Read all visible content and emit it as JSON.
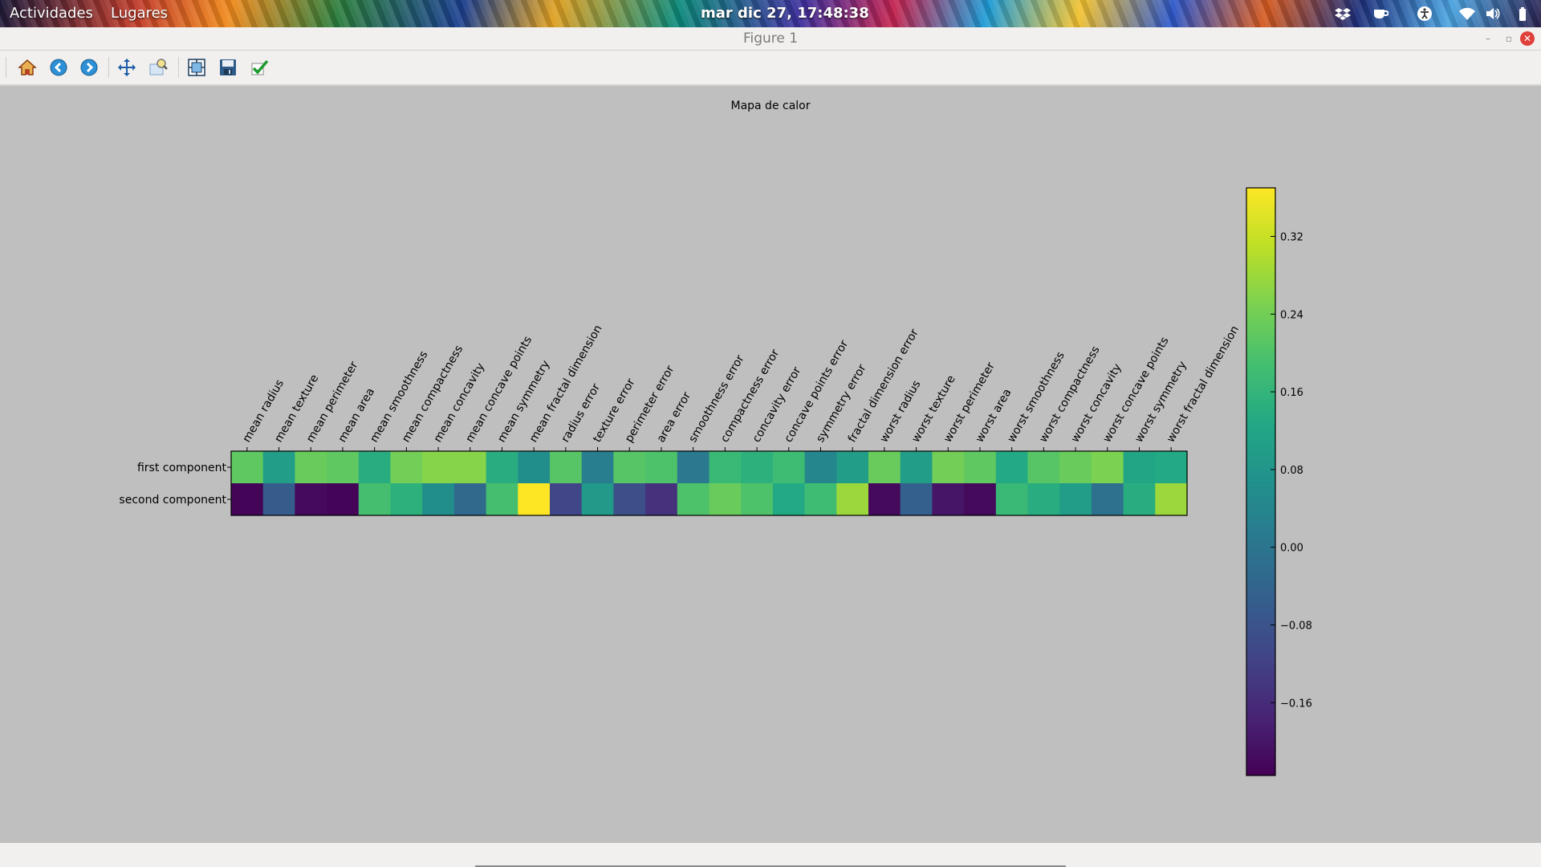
{
  "topbar": {
    "activities": "Actividades",
    "places": "Lugares",
    "clock": "mar dic 27, 17:48:38",
    "tray_icons": [
      "dropbox-icon",
      "coffee-cup-icon",
      "accessibility-icon",
      "wifi-icon",
      "volume-icon",
      "battery-icon"
    ]
  },
  "window": {
    "title": "Figure 1",
    "controls": [
      "minimize",
      "restore",
      "close"
    ]
  },
  "toolbar": {
    "tools": [
      "home-icon",
      "back-icon",
      "forward-icon",
      "pan-icon",
      "zoom-icon",
      "configure-subplots-icon",
      "save-icon",
      "edit-axis-icon"
    ]
  },
  "chart_data": {
    "type": "heatmap",
    "title": "Mapa de calor",
    "rows": [
      "first component",
      "second component"
    ],
    "columns": [
      "mean radius",
      "mean texture",
      "mean perimeter",
      "mean area",
      "mean smoothness",
      "mean compactness",
      "mean concavity",
      "mean concave points",
      "mean symmetry",
      "mean fractal dimension",
      "radius error",
      "texture error",
      "perimeter error",
      "area error",
      "smoothness error",
      "compactness error",
      "concavity error",
      "concave points error",
      "symmetry error",
      "fractal dimension error",
      "worst radius",
      "worst texture",
      "worst perimeter",
      "worst area",
      "worst smoothness",
      "worst compactness",
      "worst concavity",
      "worst concave points",
      "worst symmetry",
      "worst fractal dimension"
    ],
    "values": [
      [
        0.22,
        0.1,
        0.23,
        0.22,
        0.14,
        0.24,
        0.26,
        0.26,
        0.14,
        0.06,
        0.21,
        0.02,
        0.21,
        0.2,
        0.01,
        0.17,
        0.15,
        0.18,
        0.04,
        0.1,
        0.23,
        0.1,
        0.24,
        0.22,
        0.13,
        0.21,
        0.23,
        0.25,
        0.12,
        0.13
      ],
      [
        -0.23,
        -0.06,
        -0.22,
        -0.23,
        0.19,
        0.15,
        0.06,
        -0.03,
        0.19,
        0.37,
        -0.11,
        0.09,
        -0.09,
        -0.15,
        0.2,
        0.23,
        0.2,
        0.13,
        0.18,
        0.28,
        -0.22,
        -0.05,
        -0.2,
        -0.22,
        0.17,
        0.14,
        0.1,
        -0.01,
        0.14,
        0.28
      ]
    ],
    "colorbar": {
      "min": -0.235,
      "max": 0.37,
      "ticks": [
        0.32,
        0.24,
        0.16,
        0.08,
        0.0,
        -0.08,
        -0.16
      ],
      "tick_labels": [
        "0.32",
        "0.24",
        "0.16",
        "0.08",
        "0.00",
        "−0.08",
        "−0.16"
      ]
    },
    "colormap": "viridis"
  }
}
